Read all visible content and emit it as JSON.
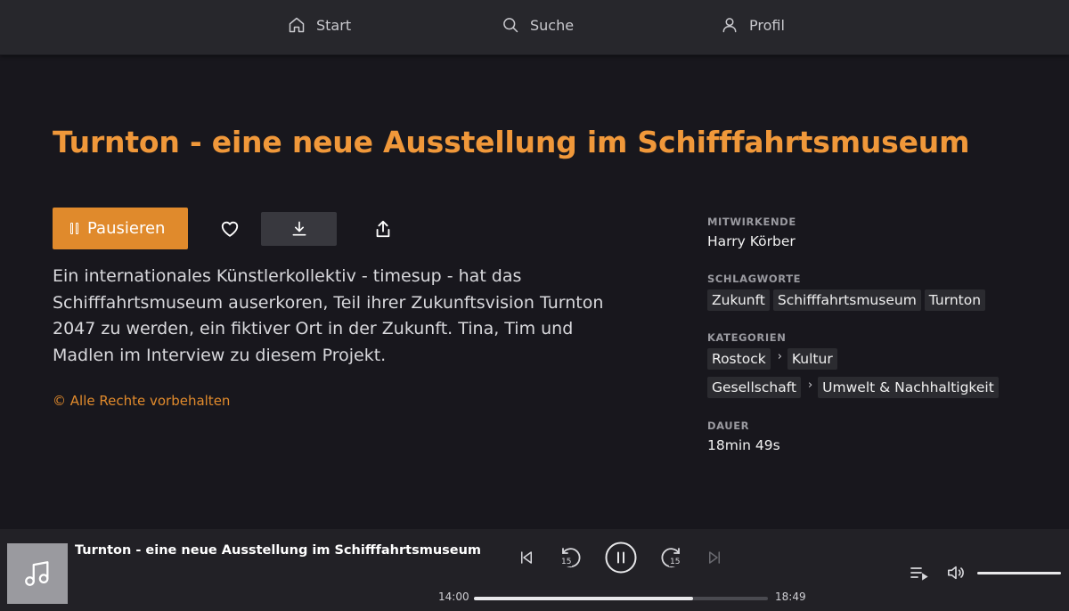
{
  "nav": {
    "start_label": "Start",
    "search_label": "Suche",
    "profile_label": "Profil"
  },
  "episode": {
    "title": "Turnton - eine neue Ausstellung im Schifffahrtsmuseum",
    "pause_label": "Pausieren",
    "description": "Ein internationales Künstlerkollektiv - timesup - hat das Schifffahrtsmuseum auserkoren, Teil ihrer Zukunftsvision Turnton 2047 zu werden, ein fiktiver Ort in der Zukunft. Tina, Tim und Madlen im Interview zu diesem Projekt.",
    "rights": "© Alle Rechte vorbehalten"
  },
  "meta": {
    "contributors_label": "Mitwirkende",
    "contributors": "Harry Körber",
    "tags_label": "Schlagworte",
    "tags": [
      "Zukunft",
      "Schifffahrtsmuseum",
      "Turnton"
    ],
    "categories_label": "Kategorien",
    "categories": [
      [
        "Rostock",
        "Kultur"
      ],
      [
        "Gesellschaft",
        "Umwelt & Nachhaltigkeit"
      ]
    ],
    "duration_label": "Dauer",
    "duration": "18min 49s"
  },
  "player": {
    "title": "Turnton - eine neue Ausstellung im Schifffahrtsmuseum",
    "elapsed": "14:00",
    "total": "18:49",
    "progress": 0.744,
    "skip_back_seconds": "15",
    "skip_forward_seconds": "15",
    "volume": 1.0
  },
  "colors": {
    "accent": "#e08a2c",
    "title": "#f0983a",
    "background": "#18171d",
    "nav": "#27272c",
    "player": "#222126"
  }
}
